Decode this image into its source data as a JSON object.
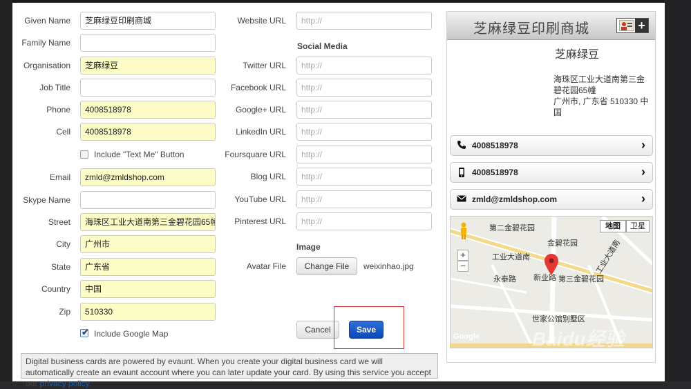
{
  "form": {
    "fields_left": [
      {
        "label": "Given Name",
        "value": "芝麻绿豆印刷商城",
        "filled": false
      },
      {
        "label": "Family Name",
        "value": "",
        "filled": false
      },
      {
        "label": "Organisation",
        "value": "芝麻绿豆",
        "filled": true
      },
      {
        "label": "Job Title",
        "value": "",
        "filled": false
      },
      {
        "label": "Phone",
        "value": "4008518978",
        "filled": true
      },
      {
        "label": "Cell",
        "value": "4008518978",
        "filled": true
      },
      {
        "label": "Email",
        "value": "zmld@zmldshop.com",
        "filled": true
      },
      {
        "label": "Skype Name",
        "value": "",
        "filled": false
      },
      {
        "label": "Street",
        "value": "海珠区工业大道南第三金碧花园65幢",
        "filled": true
      },
      {
        "label": "City",
        "value": "广州市",
        "filled": true
      },
      {
        "label": "State",
        "value": "广东省",
        "filled": true
      },
      {
        "label": "Country",
        "value": "中国",
        "filled": true
      },
      {
        "label": "Zip",
        "value": "510330",
        "filled": true
      }
    ],
    "text_me_label": "Include \"Text Me\" Button",
    "text_me_checked": false,
    "google_map_label": "Include Google Map",
    "google_map_checked": true,
    "website_label": "Website URL",
    "url_placeholder": "http://",
    "social_heading": "Social Media",
    "social_fields": [
      "Twitter URL",
      "Facebook URL",
      "Google+ URL",
      "LinkedIn URL",
      "Foursquare URL",
      "Blog URL",
      "YouTube URL",
      "Pinterest URL"
    ],
    "image_heading": "Image",
    "avatar_label": "Avatar File",
    "change_file_label": "Change File",
    "file_name": "weixinhao.jpg",
    "cancel_label": "Cancel",
    "save_label": "Save"
  },
  "notice": {
    "text": "Digital business cards are powered by evaunt. When you create your digital business card we will automatically create an evaunt account where you can later update your card. By using this service you accept our ",
    "link": "privacy policy",
    "end": "."
  },
  "preview": {
    "title": "芝麻绿豆印刷商城",
    "name": "芝麻绿豆",
    "address_line1": "海珠区工业大道南第三金碧花园65幢",
    "address_line2": "广州市, 广东省 510330 中国",
    "phone": "4008518978",
    "cell": "4008518978",
    "email": "zmld@zmldshop.com",
    "map_tab_map": "地图",
    "map_tab_satellite": "卫星",
    "map_labels": [
      "第二金碧花园",
      "金碧花园",
      "工业大道南",
      "永泰路",
      "新业路",
      "第三金碧花园",
      "世家公馆别墅区",
      "工业大道南",
      "Google"
    ],
    "map_zoom_in": "+",
    "map_zoom_out": "−"
  },
  "watermark": {
    "brand": "Baidu经验",
    "url": "jingyan.baidu.com"
  },
  "colors": {
    "filled_bg": "#fdfdc8",
    "save_blue": "#0d47b3",
    "highlight_red": "#d03030"
  }
}
